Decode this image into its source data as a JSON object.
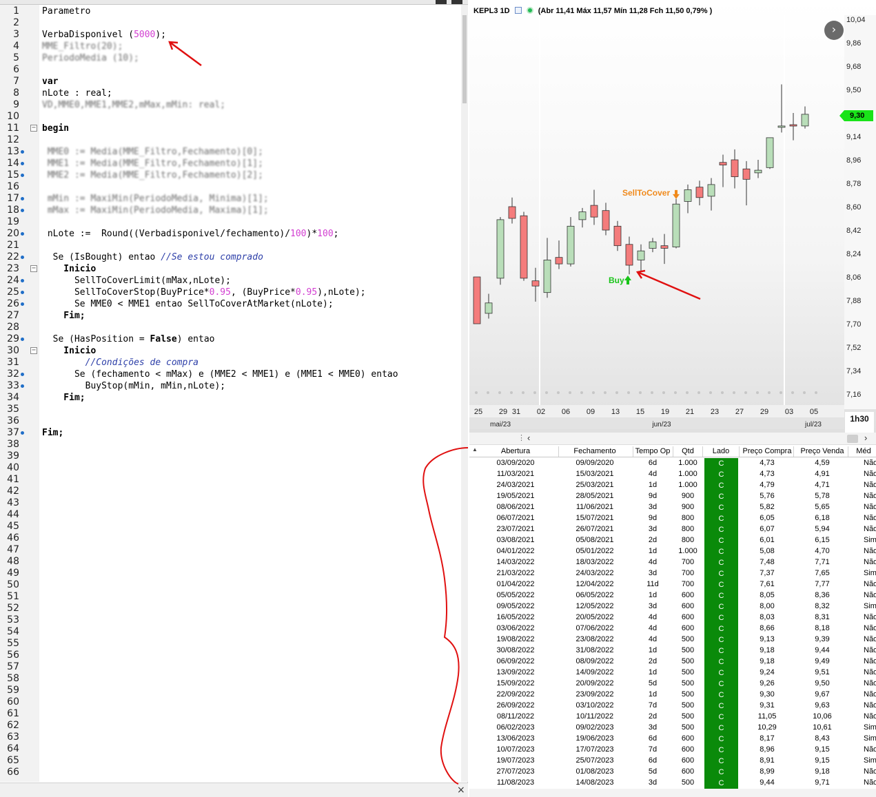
{
  "editor": {
    "code_lines": [
      {
        "n": "1",
        "segs": [
          {
            "t": "Parametro",
            "c": "plain"
          }
        ]
      },
      {
        "n": "2",
        "segs": []
      },
      {
        "n": "3",
        "segs": [
          {
            "t": "VerbaDisponivel (",
            "c": "plain"
          },
          {
            "t": "5000",
            "c": "num"
          },
          {
            "t": ");",
            "c": "plain"
          }
        ]
      },
      {
        "n": "4",
        "segs": [
          {
            "t": "MME_Filtro(20);",
            "c": "blur"
          }
        ]
      },
      {
        "n": "5",
        "segs": [
          {
            "t": "PeriodoMedia (10);",
            "c": "blur"
          }
        ]
      },
      {
        "n": "6",
        "segs": []
      },
      {
        "n": "7",
        "segs": [
          {
            "t": "var",
            "c": "kw"
          }
        ]
      },
      {
        "n": "8",
        "segs": [
          {
            "t": "nLote : real;",
            "c": "plain"
          }
        ]
      },
      {
        "n": "9",
        "segs": [
          {
            "t": "VD,MME0,MME1,MME2,mMax,mMin: real;",
            "c": "blur"
          }
        ]
      },
      {
        "n": "10",
        "segs": []
      },
      {
        "n": "11",
        "segs": [
          {
            "t": "begin",
            "c": "kw"
          }
        ]
      },
      {
        "n": "12",
        "segs": []
      },
      {
        "n": "13",
        "segs": [
          {
            "t": " MME0 := Media(MME_Filtro,Fechamento)[0];",
            "c": "blur"
          }
        ]
      },
      {
        "n": "14",
        "segs": [
          {
            "t": " MME1 := Media(MME_Filtro,Fechamento)[1];",
            "c": "blur"
          }
        ]
      },
      {
        "n": "15",
        "segs": [
          {
            "t": " MME2 := Media(MME_Filtro,Fechamento)[2];",
            "c": "blur"
          }
        ]
      },
      {
        "n": "16",
        "segs": []
      },
      {
        "n": "17",
        "segs": [
          {
            "t": " mMin := MaxiMin(PeriodoMedia, Minima)[1];",
            "c": "blur"
          }
        ]
      },
      {
        "n": "18",
        "segs": [
          {
            "t": " mMax := MaxiMin(PeriodoMedia, Maxima)[1];",
            "c": "blur"
          }
        ]
      },
      {
        "n": "19",
        "segs": []
      },
      {
        "n": "20",
        "segs": [
          {
            "t": " nLote :=  Round((Verbadisponivel/fechamento)/",
            "c": "plain"
          },
          {
            "t": "100",
            "c": "num"
          },
          {
            "t": ")*",
            "c": "plain"
          },
          {
            "t": "100",
            "c": "num"
          },
          {
            "t": ";",
            "c": "plain"
          }
        ]
      },
      {
        "n": "21",
        "segs": []
      },
      {
        "n": "22",
        "segs": [
          {
            "t": "  Se (IsBought) entao ",
            "c": "plain"
          },
          {
            "t": "//Se estou comprado",
            "c": "cmt"
          }
        ]
      },
      {
        "n": "23",
        "segs": [
          {
            "t": "    Inicio",
            "c": "kw"
          }
        ]
      },
      {
        "n": "24",
        "segs": [
          {
            "t": "      SellToCoverLimit(mMax,nLote);",
            "c": "plain"
          }
        ]
      },
      {
        "n": "25",
        "segs": [
          {
            "t": "      SellToCoverStop(BuyPrice*",
            "c": "plain"
          },
          {
            "t": "0.95",
            "c": "num"
          },
          {
            "t": ", (BuyPrice*",
            "c": "plain"
          },
          {
            "t": "0.95",
            "c": "num"
          },
          {
            "t": "),nLote);",
            "c": "plain"
          }
        ]
      },
      {
        "n": "26",
        "segs": [
          {
            "t": "      Se MME0 < MME1 entao SellToCoverAtMarket(nLote);",
            "c": "plain"
          }
        ]
      },
      {
        "n": "27",
        "segs": [
          {
            "t": "    Fim;",
            "c": "kw"
          }
        ]
      },
      {
        "n": "28",
        "segs": []
      },
      {
        "n": "29",
        "segs": [
          {
            "t": "  Se (HasPosition = ",
            "c": "plain"
          },
          {
            "t": "False",
            "c": "kw"
          },
          {
            "t": ") entao",
            "c": "plain"
          }
        ]
      },
      {
        "n": "30",
        "segs": [
          {
            "t": "    Inicio",
            "c": "kw"
          }
        ]
      },
      {
        "n": "31",
        "segs": [
          {
            "t": "        ",
            "c": "plain"
          },
          {
            "t": "//Condições de compra",
            "c": "cmt"
          }
        ]
      },
      {
        "n": "32",
        "segs": [
          {
            "t": "      Se (fechamento < mMax) e (MME2 < MME1) e (MME1 < MME0) entao",
            "c": "plain"
          }
        ]
      },
      {
        "n": "33",
        "segs": [
          {
            "t": "        BuyStop(mMin, mMin,nLote);",
            "c": "plain"
          }
        ]
      },
      {
        "n": "34",
        "segs": [
          {
            "t": "    Fim;",
            "c": "kw"
          }
        ]
      },
      {
        "n": "35",
        "segs": []
      },
      {
        "n": "36",
        "segs": []
      },
      {
        "n": "37",
        "segs": [
          {
            "t": "Fim;",
            "c": "kw"
          }
        ]
      },
      {
        "n": "38",
        "segs": []
      },
      {
        "n": "39",
        "segs": []
      },
      {
        "n": "40",
        "segs": []
      },
      {
        "n": "41",
        "segs": []
      },
      {
        "n": "42",
        "segs": []
      },
      {
        "n": "43",
        "segs": []
      },
      {
        "n": "44",
        "segs": []
      },
      {
        "n": "45",
        "segs": []
      },
      {
        "n": "46",
        "segs": []
      },
      {
        "n": "47",
        "segs": []
      },
      {
        "n": "48",
        "segs": []
      },
      {
        "n": "49",
        "segs": []
      },
      {
        "n": "50",
        "segs": []
      },
      {
        "n": "51",
        "segs": []
      },
      {
        "n": "52",
        "segs": []
      },
      {
        "n": "53",
        "segs": []
      },
      {
        "n": "54",
        "segs": []
      },
      {
        "n": "55",
        "segs": []
      },
      {
        "n": "56",
        "segs": []
      },
      {
        "n": "57",
        "segs": []
      },
      {
        "n": "58",
        "segs": []
      },
      {
        "n": "59",
        "segs": []
      },
      {
        "n": "60",
        "segs": []
      },
      {
        "n": "61",
        "segs": []
      },
      {
        "n": "62",
        "segs": []
      },
      {
        "n": "63",
        "segs": []
      },
      {
        "n": "64",
        "segs": []
      },
      {
        "n": "65",
        "segs": []
      },
      {
        "n": "66",
        "segs": []
      }
    ],
    "breakpoint_lines": [
      "13",
      "14",
      "15",
      "17",
      "18",
      "20",
      "22",
      "24",
      "25",
      "26",
      "29",
      "32",
      "33",
      "37"
    ],
    "fold_lines": [
      "11",
      "23",
      "30"
    ],
    "close_glyph": "×"
  },
  "chart": {
    "symbol": "KEPL3 1D",
    "ohlc_text": "(Abr 11,41 Máx 11,57 Mín 11,28 Fch 11,50 0,79% )",
    "last_price": "9,30",
    "timeframe": "1h30",
    "next_glyph": "›",
    "annotations": {
      "sell": "SellToCover",
      "buy": "Buy"
    }
  },
  "chart_data": {
    "type": "candlestick",
    "title": "KEPL3 1D",
    "y_ticks": [
      "10,04",
      "9,86",
      "9,68",
      "9,50",
      "9,32",
      "9,14",
      "8,96",
      "8,78",
      "8,60",
      "8,42",
      "8,24",
      "8,06",
      "7,88",
      "7,70",
      "7,52",
      "7,34",
      "7,16"
    ],
    "ylim": [
      7.16,
      10.04
    ],
    "x_ticks": [
      "25",
      "29",
      "31",
      "02",
      "06",
      "09",
      "13",
      "15",
      "19",
      "21",
      "23",
      "27",
      "29",
      "03",
      "05"
    ],
    "months": [
      "mai/23",
      "jun/23",
      "jul/23"
    ],
    "candles": [
      {
        "o": 8.06,
        "h": 8.06,
        "l": 7.7,
        "c": 7.7
      },
      {
        "o": 7.78,
        "h": 7.93,
        "l": 7.74,
        "c": 7.86
      },
      {
        "o": 8.05,
        "h": 8.52,
        "l": 8.0,
        "c": 8.5
      },
      {
        "o": 8.6,
        "h": 8.67,
        "l": 8.47,
        "c": 8.51
      },
      {
        "o": 8.53,
        "h": 8.56,
        "l": 8.03,
        "c": 8.05
      },
      {
        "o": 8.03,
        "h": 8.13,
        "l": 7.87,
        "c": 7.99
      },
      {
        "o": 7.94,
        "h": 8.36,
        "l": 7.9,
        "c": 8.19
      },
      {
        "o": 8.21,
        "h": 8.34,
        "l": 8.12,
        "c": 8.16
      },
      {
        "o": 8.16,
        "h": 8.52,
        "l": 8.14,
        "c": 8.45
      },
      {
        "o": 8.5,
        "h": 8.59,
        "l": 8.44,
        "c": 8.56
      },
      {
        "o": 8.61,
        "h": 8.73,
        "l": 8.46,
        "c": 8.52
      },
      {
        "o": 8.57,
        "h": 8.63,
        "l": 8.38,
        "c": 8.42
      },
      {
        "o": 8.45,
        "h": 8.49,
        "l": 8.26,
        "c": 8.3
      },
      {
        "o": 8.31,
        "h": 8.37,
        "l": 8.08,
        "c": 8.15
      },
      {
        "o": 8.19,
        "h": 8.31,
        "l": 8.1,
        "c": 8.26
      },
      {
        "o": 8.28,
        "h": 8.36,
        "l": 8.25,
        "c": 8.33
      },
      {
        "o": 8.3,
        "h": 8.39,
        "l": 8.16,
        "c": 8.28
      },
      {
        "o": 8.29,
        "h": 8.66,
        "l": 8.28,
        "c": 8.62
      },
      {
        "o": 8.64,
        "h": 8.77,
        "l": 8.55,
        "c": 8.73
      },
      {
        "o": 8.75,
        "h": 8.8,
        "l": 8.61,
        "c": 8.67
      },
      {
        "o": 8.68,
        "h": 8.82,
        "l": 8.57,
        "c": 8.77
      },
      {
        "o": 8.94,
        "h": 9.0,
        "l": 8.75,
        "c": 8.92
      },
      {
        "o": 8.96,
        "h": 9.04,
        "l": 8.74,
        "c": 8.83
      },
      {
        "o": 8.89,
        "h": 8.95,
        "l": 8.61,
        "c": 8.81
      },
      {
        "o": 8.86,
        "h": 8.96,
        "l": 8.82,
        "c": 8.88
      },
      {
        "o": 8.9,
        "h": 9.13,
        "l": 8.89,
        "c": 9.13
      },
      {
        "o": 9.22,
        "h": 9.54,
        "l": 9.17,
        "c": 9.22
      },
      {
        "o": 9.23,
        "h": 9.32,
        "l": 9.11,
        "c": 9.22
      },
      {
        "o": 9.22,
        "h": 9.37,
        "l": 9.2,
        "c": 9.31
      }
    ],
    "signals": [
      {
        "label": "SellToCover",
        "index": 17,
        "price": 8.68
      },
      {
        "label": "Buy",
        "index": 13,
        "price": 8.06
      }
    ],
    "last_price": 9.3
  },
  "trades": {
    "columns": [
      "Abertura",
      "Fechamento",
      "Tempo Op",
      "Qtd",
      "Lado",
      "Preço Compra",
      "Preço Venda",
      "Méd"
    ],
    "rows": [
      [
        "03/09/2020",
        "09/09/2020",
        "6d",
        "1.000",
        "C",
        "4,73",
        "4,59",
        "Não"
      ],
      [
        "11/03/2021",
        "15/03/2021",
        "4d",
        "1.000",
        "C",
        "4,73",
        "4,91",
        "Não"
      ],
      [
        "24/03/2021",
        "25/03/2021",
        "1d",
        "1.000",
        "C",
        "4,79",
        "4,71",
        "Não"
      ],
      [
        "19/05/2021",
        "28/05/2021",
        "9d",
        "900",
        "C",
        "5,76",
        "5,78",
        "Não"
      ],
      [
        "08/06/2021",
        "11/06/2021",
        "3d",
        "900",
        "C",
        "5,82",
        "5,65",
        "Não"
      ],
      [
        "06/07/2021",
        "15/07/2021",
        "9d",
        "800",
        "C",
        "6,05",
        "6,18",
        "Não"
      ],
      [
        "23/07/2021",
        "26/07/2021",
        "3d",
        "800",
        "C",
        "6,07",
        "5,94",
        "Não"
      ],
      [
        "03/08/2021",
        "05/08/2021",
        "2d",
        "800",
        "C",
        "6,01",
        "6,15",
        "Sim"
      ],
      [
        "04/01/2022",
        "05/01/2022",
        "1d",
        "1.000",
        "C",
        "5,08",
        "4,70",
        "Não"
      ],
      [
        "14/03/2022",
        "18/03/2022",
        "4d",
        "700",
        "C",
        "7,48",
        "7,71",
        "Não"
      ],
      [
        "21/03/2022",
        "24/03/2022",
        "3d",
        "700",
        "C",
        "7,37",
        "7,65",
        "Sim"
      ],
      [
        "01/04/2022",
        "12/04/2022",
        "11d",
        "700",
        "C",
        "7,61",
        "7,77",
        "Não"
      ],
      [
        "05/05/2022",
        "06/05/2022",
        "1d",
        "600",
        "C",
        "8,05",
        "8,36",
        "Não"
      ],
      [
        "09/05/2022",
        "12/05/2022",
        "3d",
        "600",
        "C",
        "8,00",
        "8,32",
        "Sim"
      ],
      [
        "16/05/2022",
        "20/05/2022",
        "4d",
        "600",
        "C",
        "8,03",
        "8,31",
        "Não"
      ],
      [
        "03/06/2022",
        "07/06/2022",
        "4d",
        "600",
        "C",
        "8,66",
        "8,18",
        "Não"
      ],
      [
        "19/08/2022",
        "23/08/2022",
        "4d",
        "500",
        "C",
        "9,13",
        "9,39",
        "Não"
      ],
      [
        "30/08/2022",
        "31/08/2022",
        "1d",
        "500",
        "C",
        "9,18",
        "9,44",
        "Não"
      ],
      [
        "06/09/2022",
        "08/09/2022",
        "2d",
        "500",
        "C",
        "9,18",
        "9,49",
        "Não"
      ],
      [
        "13/09/2022",
        "14/09/2022",
        "1d",
        "500",
        "C",
        "9,24",
        "9,51",
        "Não"
      ],
      [
        "15/09/2022",
        "20/09/2022",
        "5d",
        "500",
        "C",
        "9,26",
        "9,50",
        "Não"
      ],
      [
        "22/09/2022",
        "23/09/2022",
        "1d",
        "500",
        "C",
        "9,30",
        "9,67",
        "Não"
      ],
      [
        "26/09/2022",
        "03/10/2022",
        "7d",
        "500",
        "C",
        "9,31",
        "9,63",
        "Não"
      ],
      [
        "08/11/2022",
        "10/11/2022",
        "2d",
        "500",
        "C",
        "11,05",
        "10,06",
        "Não"
      ],
      [
        "06/02/2023",
        "09/02/2023",
        "3d",
        "500",
        "C",
        "10,29",
        "10,61",
        "Sim"
      ],
      [
        "13/06/2023",
        "19/06/2023",
        "6d",
        "600",
        "C",
        "8,17",
        "8,43",
        "Sim"
      ],
      [
        "10/07/2023",
        "17/07/2023",
        "7d",
        "600",
        "C",
        "8,96",
        "9,15",
        "Não"
      ],
      [
        "19/07/2023",
        "25/07/2023",
        "6d",
        "600",
        "C",
        "8,91",
        "9,15",
        "Sim"
      ],
      [
        "27/07/2023",
        "01/08/2023",
        "5d",
        "600",
        "C",
        "8,99",
        "9,18",
        "Não"
      ],
      [
        "11/08/2023",
        "14/08/2023",
        "3d",
        "500",
        "C",
        "9,44",
        "9,71",
        "Não"
      ]
    ]
  },
  "colors": {
    "up_fill": "#b9deb9",
    "down_fill": "#f47c7c",
    "candle_outline": "#333333",
    "side_cell": "#0a8a0a",
    "sell_label": "#f08a1c",
    "buy_label": "#18c418",
    "price_tag": "#19e319",
    "annotation_red": "#e01010"
  }
}
